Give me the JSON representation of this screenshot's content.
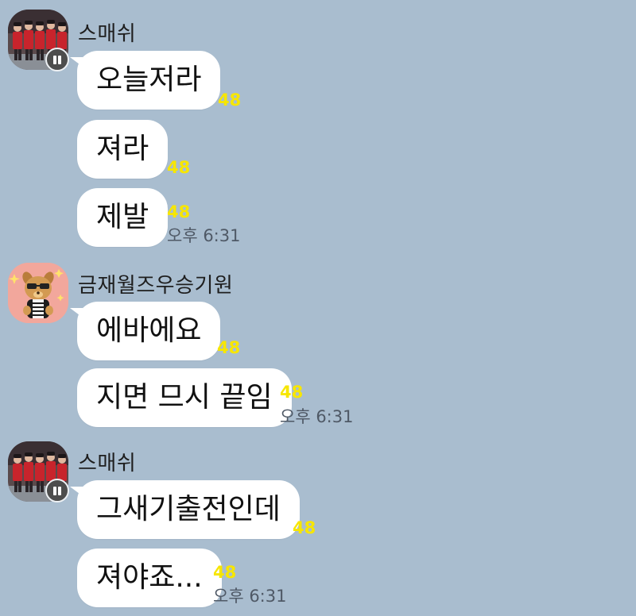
{
  "groups": [
    {
      "sender": "스매쉬",
      "avatar": "team-photo-avatar",
      "messages": [
        {
          "text": "오늘저라",
          "unread": "48",
          "time": ""
        },
        {
          "text": "져라",
          "unread": "48",
          "time": ""
        },
        {
          "text": "제발",
          "unread": "48",
          "time": "오후 6:31"
        }
      ]
    },
    {
      "sender": "금재월즈우승기원",
      "avatar": "cartoon-character-avatar",
      "messages": [
        {
          "text": "에바에요",
          "unread": "48",
          "time": ""
        },
        {
          "text": "지면 므시 끝임",
          "unread": "48",
          "time": "오후 6:31"
        }
      ]
    },
    {
      "sender": "스매쉬",
      "avatar": "team-photo-avatar",
      "messages": [
        {
          "text": "그새기출전인데",
          "unread": "48",
          "time": ""
        },
        {
          "text": "져야죠...",
          "unread": "48",
          "time": "오후 6:31"
        }
      ]
    }
  ],
  "colors": {
    "background": "#a9bdcf",
    "bubble": "#ffffff",
    "unread": "#f7e600",
    "time": "#4f5966"
  }
}
